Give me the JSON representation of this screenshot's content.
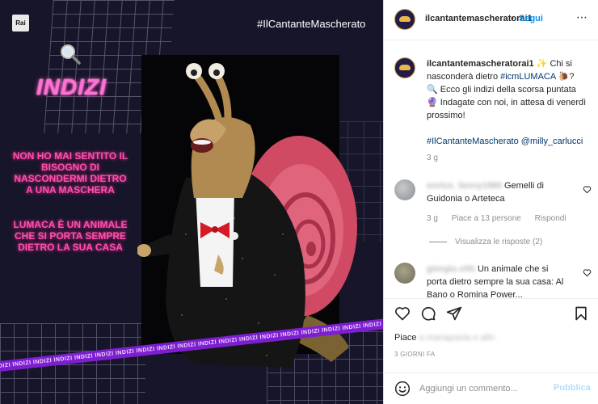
{
  "media": {
    "channel_logo": "Rai",
    "hashtag": "#IlCantanteMascherato",
    "title": "INDIZI",
    "clue_1": "NON HO MAI SENTITO IL BISOGNO DI NASCONDERMI DIETRO A UNA MASCHERA",
    "clue_2": "LUMACA È UN ANIMALE CHE SI PORTA SEMPRE DIETRO LA SUA CASA",
    "ribbon_text": "INDIZI INDIZI INDIZI INDIZI INDIZI INDIZI INDIZI INDIZI INDIZI INDIZI INDIZI INDIZI INDIZI INDIZI INDIZI INDIZI INDIZI INDIZI INDIZI INDIZI INDIZI INDIZI",
    "icons": [
      "magnifier-icon",
      "snail-costume"
    ],
    "colors": {
      "background": "#17152a",
      "neon_pink": "#ff4fae",
      "ribbon": "#7d1fd0"
    }
  },
  "header": {
    "username": "ilcantantemascheratorai1",
    "separator": "•",
    "follow_label": "Segui",
    "more_icon": "⋯"
  },
  "caption": {
    "username": "ilcantantemascheratorai1",
    "line1": "✨ Chi si nasconderà dietro",
    "hashtag1": "#icmLUMACA",
    "line1_end": "🐌?",
    "line2": "🔍 Ecco gli indizi della scorsa puntata",
    "line3": "🔮 Indagate con noi, in attesa di venerdì prossimo!",
    "hashtag2": "#IlCantanteMascherato",
    "mention": "@milly_carlucci",
    "time": "3 g"
  },
  "comments": [
    {
      "username": "enrico_fanny1980",
      "text": "Gemelli di Guidonia o Arteteca",
      "time": "3 g",
      "likes": "Piace a 13 persone",
      "reply_label": "Rispondi",
      "view_replies": "Visualizza le risposte (2)"
    },
    {
      "username": "giorgio.vitti",
      "text": "Un animale che si porta dietro sempre la sua casa: Al Bano o Romina Power..."
    }
  ],
  "actions": {
    "likes_prefix": "Piace",
    "likes_blurred": "a mariapaola e altri",
    "post_time": "3 GIORNI FA"
  },
  "add_comment": {
    "placeholder": "Aggiungi un commento...",
    "publish_label": "Pubblica"
  }
}
